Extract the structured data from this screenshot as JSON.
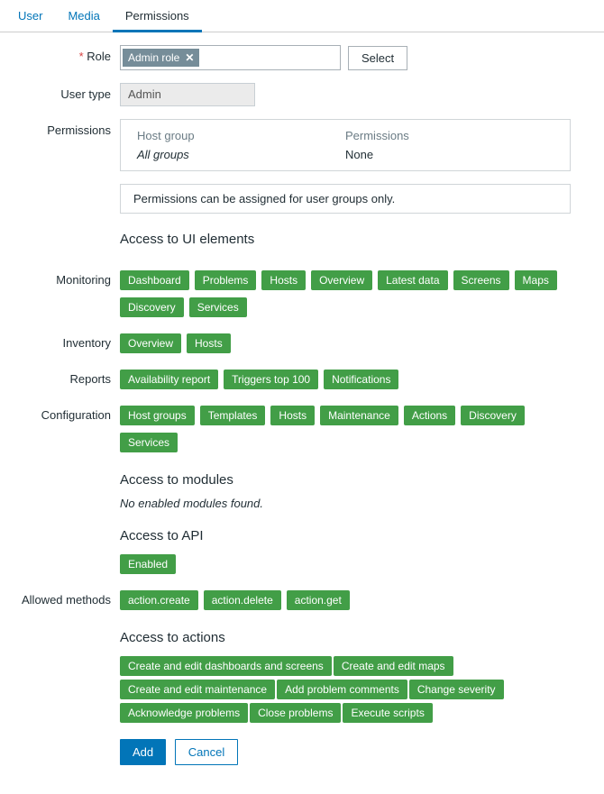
{
  "tabs": {
    "user": "User",
    "media": "Media",
    "permissions": "Permissions"
  },
  "labels": {
    "role": "Role",
    "user_type": "User type",
    "permissions": "Permissions",
    "monitoring": "Monitoring",
    "inventory": "Inventory",
    "reports": "Reports",
    "configuration": "Configuration",
    "allowed_methods": "Allowed methods"
  },
  "role": {
    "chip": "Admin role",
    "select_btn": "Select"
  },
  "user_type": {
    "value": "Admin"
  },
  "perm_box": {
    "host_group_h": "Host group",
    "host_group_v": "All groups",
    "perm_h": "Permissions",
    "perm_v": "None"
  },
  "notice": "Permissions can be assigned for user groups only.",
  "sections": {
    "ui": "Access to UI elements",
    "modules_title": "Access to modules",
    "modules_none": "No enabled modules found.",
    "api_title": "Access to API",
    "actions_title": "Access to actions"
  },
  "monitoring": [
    "Dashboard",
    "Problems",
    "Hosts",
    "Overview",
    "Latest data",
    "Screens",
    "Maps",
    "Discovery",
    "Services"
  ],
  "inventory": [
    "Overview",
    "Hosts"
  ],
  "reports": [
    "Availability report",
    "Triggers top 100",
    "Notifications"
  ],
  "configuration": [
    "Host groups",
    "Templates",
    "Hosts",
    "Maintenance",
    "Actions",
    "Discovery",
    "Services"
  ],
  "api": {
    "enabled": "Enabled"
  },
  "allowed_methods": [
    "action.create",
    "action.delete",
    "action.get"
  ],
  "actions": [
    "Create and edit dashboards and screens",
    "Create and edit maps",
    "Create and edit maintenance",
    "Add problem comments",
    "Change severity",
    "Acknowledge problems",
    "Close problems",
    "Execute scripts"
  ],
  "buttons": {
    "add": "Add",
    "cancel": "Cancel"
  }
}
